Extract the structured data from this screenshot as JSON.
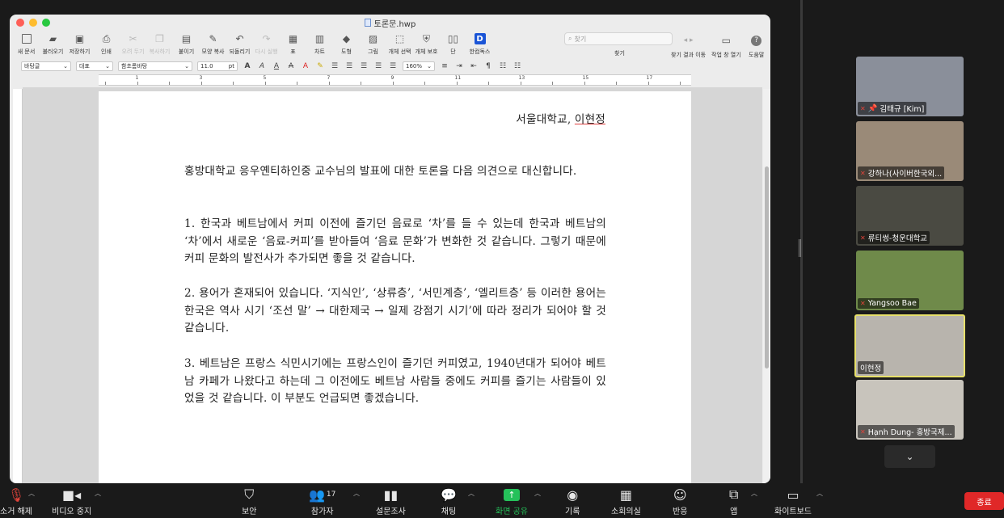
{
  "window": {
    "filename": "토론문.hwp"
  },
  "toolbar": {
    "items": [
      {
        "label": "새 문서",
        "icon": "new-doc-icon"
      },
      {
        "label": "불러오기",
        "icon": "folder-icon"
      },
      {
        "label": "저장하기",
        "icon": "save-icon"
      },
      {
        "label": "인쇄",
        "icon": "print-icon"
      },
      {
        "label": "오려 두기",
        "icon": "cut-icon"
      },
      {
        "label": "복사하기",
        "icon": "copy-icon"
      },
      {
        "label": "붙이기",
        "icon": "paste-icon"
      },
      {
        "label": "모양 복사",
        "icon": "format-copy-icon"
      },
      {
        "label": "되돌리기",
        "icon": "undo-icon"
      },
      {
        "label": "다시 실행",
        "icon": "redo-icon"
      },
      {
        "label": "표",
        "icon": "table-icon"
      },
      {
        "label": "차트",
        "icon": "chart-icon"
      },
      {
        "label": "도형",
        "icon": "shape-icon"
      },
      {
        "label": "그림",
        "icon": "picture-icon"
      },
      {
        "label": "개체 선택",
        "icon": "select-object-icon"
      },
      {
        "label": "개체 보호",
        "icon": "protect-object-icon"
      },
      {
        "label": "단",
        "icon": "columns-icon"
      },
      {
        "label": "한컴독스",
        "icon": "hancom-docs-icon"
      }
    ],
    "search_placeholder": "찾기",
    "search_label": "찾기",
    "find_results_label": "찾기 결과 이동",
    "task_pane_label": "작업 창 열기",
    "help_label": "도움말"
  },
  "format": {
    "style": "바탕글",
    "lang": "대표",
    "font": "함초롬바탕",
    "size": "11.0",
    "unit": "pt",
    "zoom": "160%"
  },
  "document": {
    "affiliation_prefix": "서울대학교, ",
    "affiliation_name": "이현정",
    "para0": "홍방대학교 응우옌티하인중 교수님의 발표에 대한 토론을 다음 의견으로 대신합니다.",
    "para1": "1. 한국과 베트남에서 커피 이전에 즐기던 음료로 ‘차’를 들 수 있는데 한국과 베트남의 ‘차’에서 새로운 ‘음료-커피’를 받아들여 ‘음료 문화’가 변화한 것 같습니다. 그렇기 때문에 커피 문화의 발전사가 추가되면 좋을 것 같습니다.",
    "para2": "2. 용어가 혼재되어 있습니다. ‘지식인’, ‘상류층’, ‘서민계층’, ‘엘리트층’ 등 이러한 용어는 한국은 역사 시기 ‘조선 말’ → 대한제국 → 일제 강점기 시기’에 따라 정리가 되어야 할 것 같습니다.",
    "para3": "3. 베트남은 프랑스 식민시기에는 프랑스인이 즐기던 커피였고, 1940년대가 되어야 베트남 카페가 나왔다고 하는데 그 이전에도 베트남 사람들 중에도 커피를 즐기는 사람들이 있었을 것 같습니다. 이 부분도 언급되면 좋겠습니다."
  },
  "participants": [
    {
      "name": "김태규 [Kim]",
      "muted": false,
      "pinned": true,
      "bg": "#8a8f9a"
    },
    {
      "name": "강하나(사이버한국외...",
      "muted": true,
      "bg": "#9a8a78"
    },
    {
      "name": "류티썽-청운대학교",
      "muted": true,
      "bg": "#4a4a42"
    },
    {
      "name": "Yangsoo Bae",
      "muted": true,
      "bg": "#6f8a4a"
    },
    {
      "name": "이현정",
      "muted": false,
      "active": true,
      "bg": "#b8b4ad"
    },
    {
      "name": "Hạnh Dung- 홍방국제...",
      "muted": true,
      "bg": "#c8c4bc"
    }
  ],
  "zoom_toolbar": {
    "items": [
      {
        "label": "소거 해제",
        "icon": "mic-muted-icon"
      },
      {
        "label": "비디오 중지",
        "icon": "video-icon"
      },
      {
        "label": "보안",
        "icon": "shield-icon"
      },
      {
        "label": "참가자",
        "icon": "participants-icon",
        "count": "17"
      },
      {
        "label": "설문조사",
        "icon": "poll-icon"
      },
      {
        "label": "채팅",
        "icon": "chat-icon"
      },
      {
        "label": "화면 공유",
        "icon": "share-screen-icon"
      },
      {
        "label": "기록",
        "icon": "record-icon"
      },
      {
        "label": "소회의실",
        "icon": "breakout-icon"
      },
      {
        "label": "반응",
        "icon": "reaction-icon"
      },
      {
        "label": "앱",
        "icon": "apps-icon"
      },
      {
        "label": "화이트보드",
        "icon": "whiteboard-icon"
      }
    ],
    "end_label": "종료",
    "accent_green": "#25c15a",
    "end_red": "#e02828"
  }
}
